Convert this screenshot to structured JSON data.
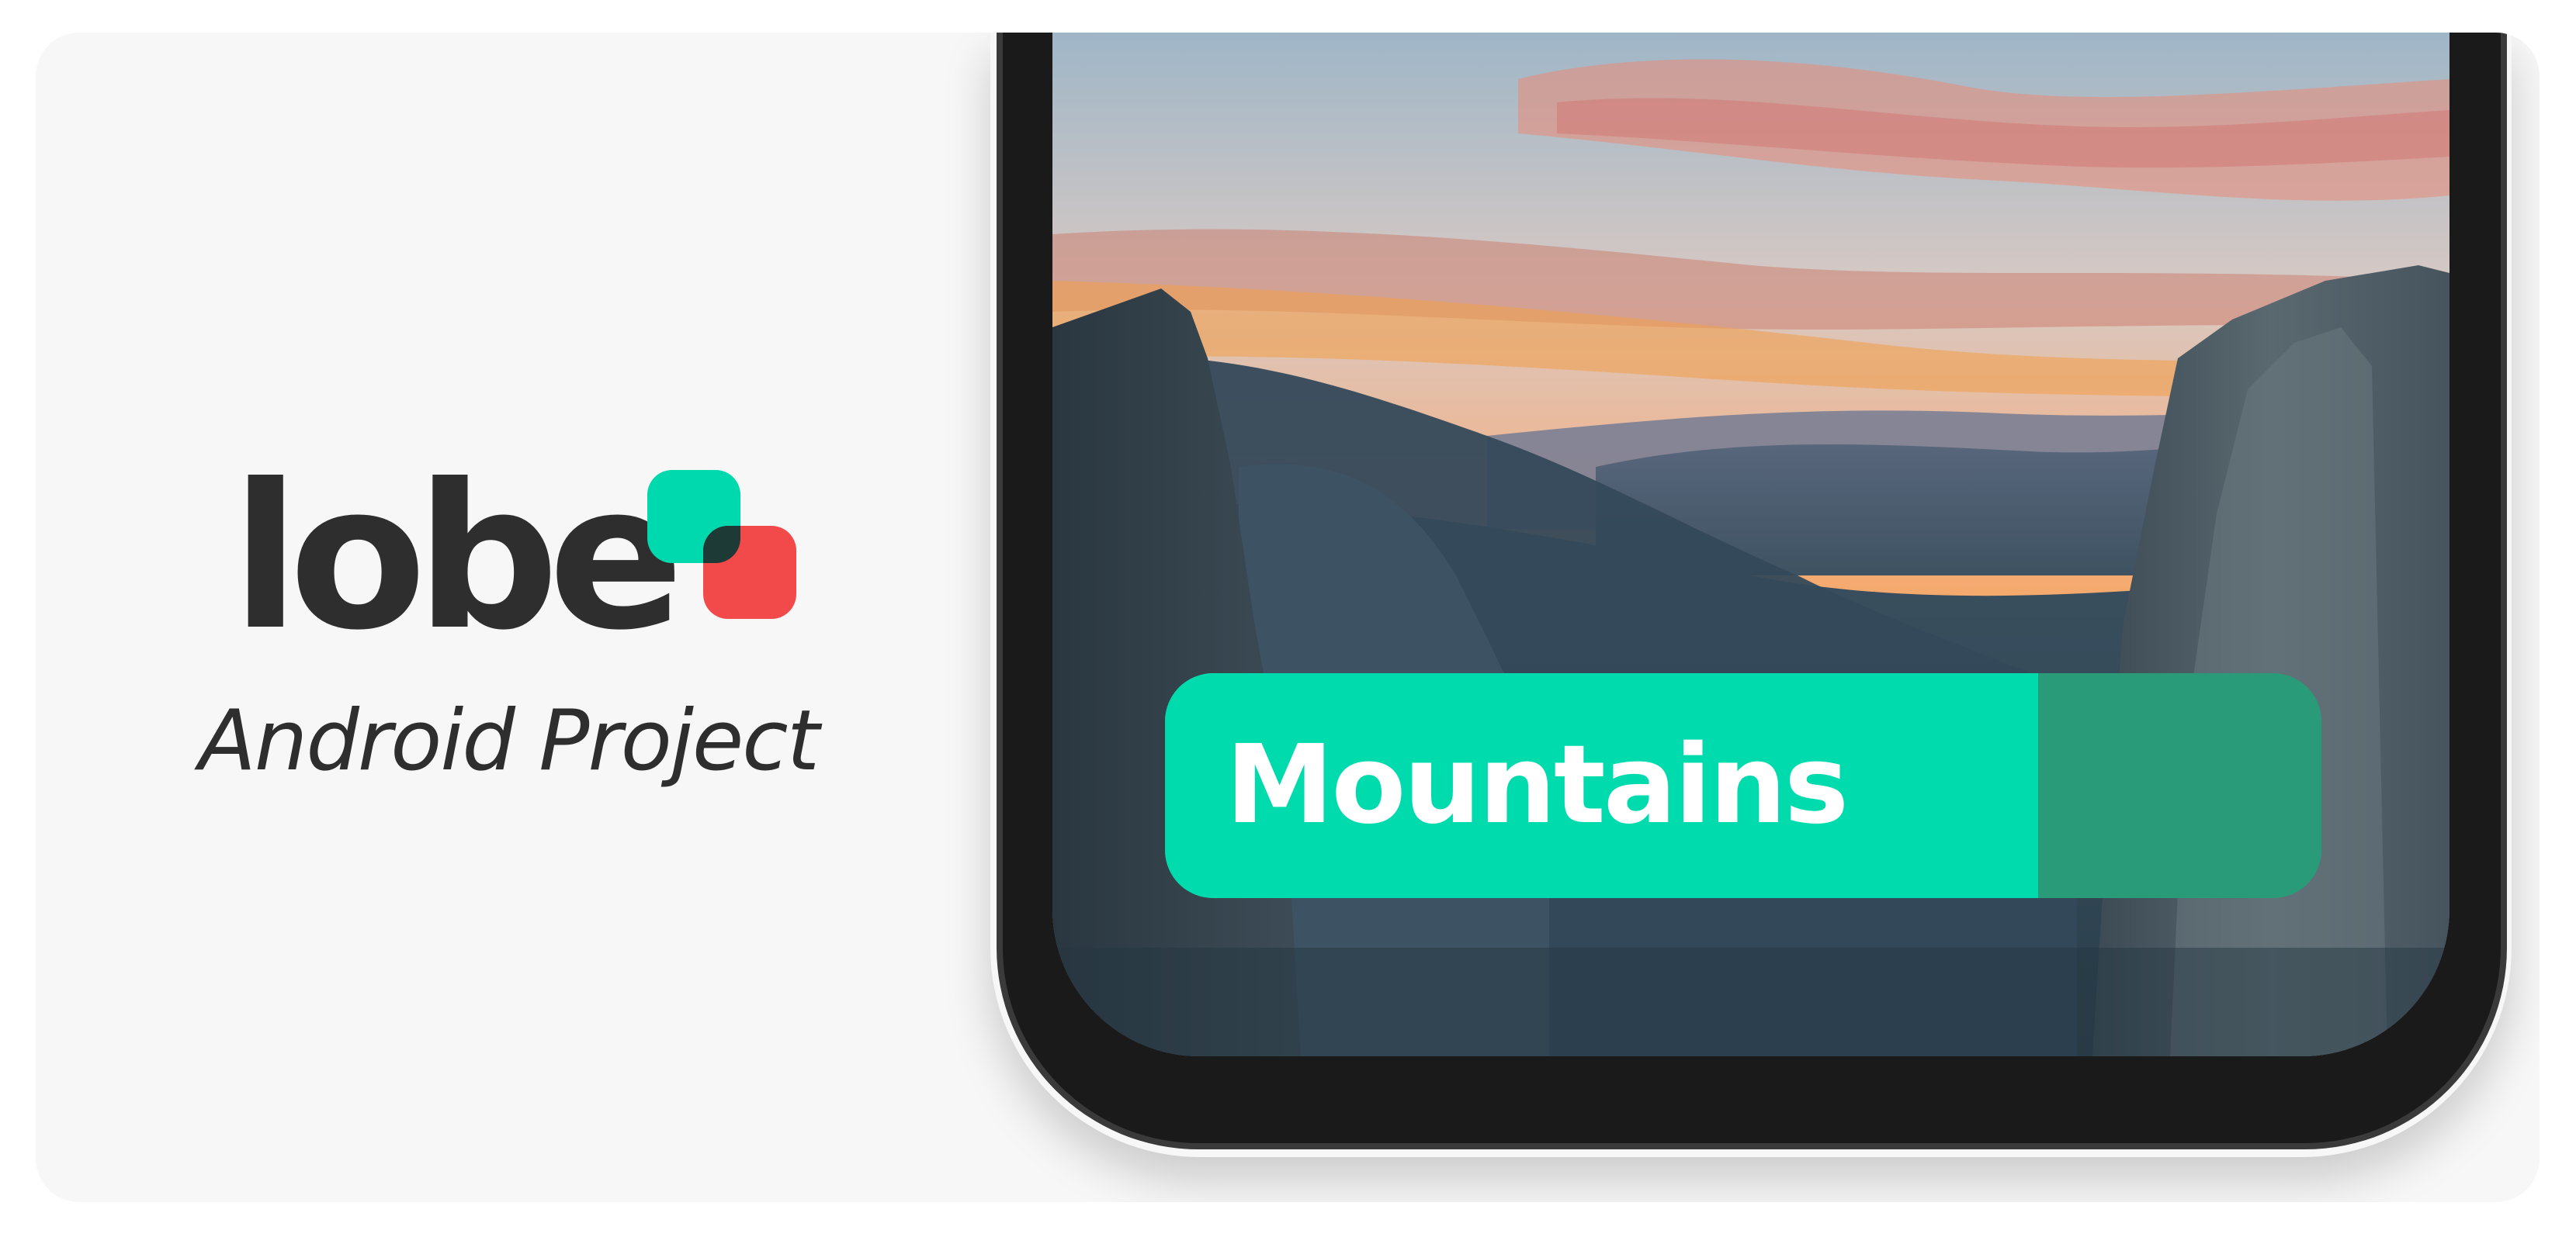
{
  "brand": {
    "wordmark": "lobe",
    "subtitle": "Android Project",
    "logo_icon": "lobe-logo-icon",
    "colors": {
      "teal": "#00d9ad",
      "red": "#f24a4a",
      "overlap": "#1d3a36",
      "text": "#2e2e2e"
    }
  },
  "phone": {
    "screen_image": "mountain-valley-sunset-image",
    "prediction": {
      "label": "Mountains",
      "confidence": 0.755,
      "colors": {
        "fill": "#00dbae",
        "remainder": "#2a9b79"
      }
    }
  }
}
